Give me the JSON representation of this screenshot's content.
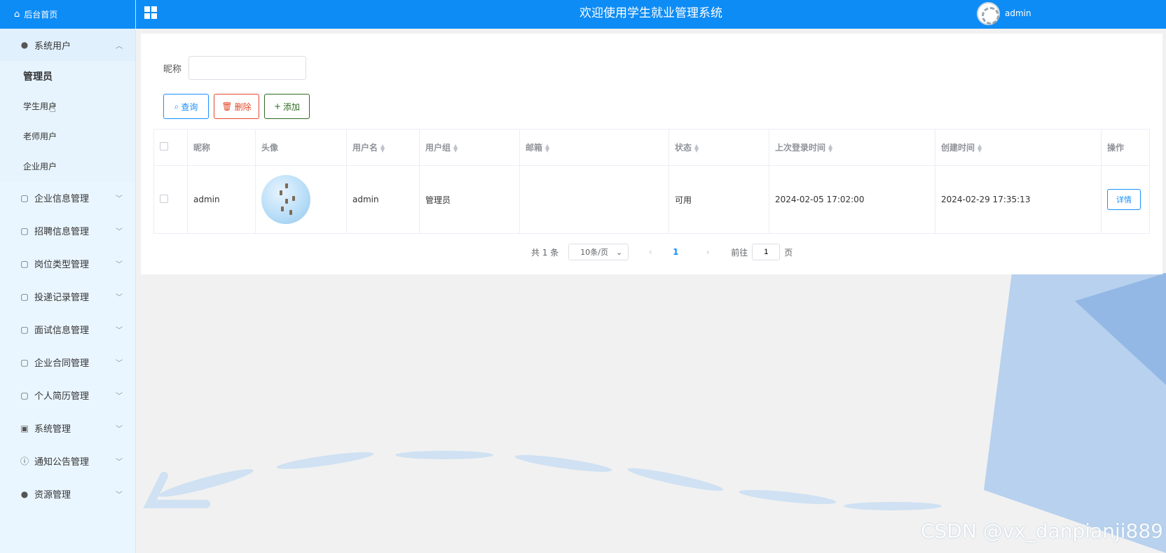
{
  "sidebar": {
    "home_label": "后台首页",
    "open_group": {
      "label": "系统用户",
      "icon": "person-icon"
    },
    "submenu": [
      "管理员",
      "学生用户",
      "老师用户",
      "企业用户"
    ],
    "groups": [
      {
        "label": "企业信息管理",
        "icon": "tablet-icon"
      },
      {
        "label": "招聘信息管理",
        "icon": "tablet-icon"
      },
      {
        "label": "岗位类型管理",
        "icon": "tablet-icon"
      },
      {
        "label": "投递记录管理",
        "icon": "tablet-icon"
      },
      {
        "label": "面试信息管理",
        "icon": "tablet-icon"
      },
      {
        "label": "企业合同管理",
        "icon": "tablet-icon"
      },
      {
        "label": "个人简历管理",
        "icon": "tablet-icon"
      },
      {
        "label": "系统管理",
        "icon": "picture-icon"
      },
      {
        "label": "通知公告管理",
        "icon": "info-icon"
      },
      {
        "label": "资源管理",
        "icon": "bulb-icon"
      }
    ]
  },
  "header": {
    "title": "欢迎使用学生就业管理系统",
    "user": "admin"
  },
  "search": {
    "label": "昵称",
    "value": ""
  },
  "toolbar": {
    "query": "查询",
    "delete": "删除",
    "add": "添加"
  },
  "table": {
    "columns": [
      "昵称",
      "头像",
      "用户名",
      "用户组",
      "邮箱",
      "状态",
      "上次登录时间",
      "创建时间",
      "操作"
    ],
    "rows": [
      {
        "nickname": "admin",
        "username": "admin",
        "group": "管理员",
        "email": "",
        "status": "可用",
        "last_login": "2024-02-05 17:02:00",
        "created": "2024-02-29 17:35:13",
        "action": "详情"
      }
    ]
  },
  "pagination": {
    "total": "共 1 条",
    "page_size": "10条/页",
    "current": "1",
    "goto_prefix": "前往",
    "goto_value": "1",
    "goto_suffix": "页"
  },
  "watermark": "CSDN @vx_danpianji889",
  "colors": {
    "primary": "#0e8cf5",
    "danger": "#e4472b",
    "success": "#2d6a1f"
  }
}
